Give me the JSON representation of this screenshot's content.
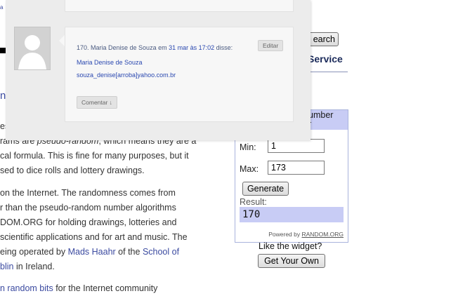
{
  "page": {
    "top_link": "a",
    "left_link": "n",
    "search_button_label": "earch",
    "service_title": "Service",
    "lines": [
      {
        "pre": "es",
        "em": "",
        "post": ""
      },
      {
        "pre": "rams are ",
        "em": "pseudo-random",
        "post": ", which means they are a"
      },
      {
        "pre": "cal formula. This is fine for many purposes, but it",
        "em": "",
        "post": ""
      },
      {
        "pre": "sed to dice rolls and lottery drawings.",
        "em": "",
        "post": ""
      },
      {
        "pre": "on the Internet. The randomness comes from",
        "em": "",
        "post": ""
      },
      {
        "pre": "r than the pseudo-random number algorithms",
        "em": "",
        "post": ""
      },
      {
        "pre": "DOM.ORG for holding drawings, lotteries and",
        "em": "",
        "post": ""
      },
      {
        "pre": "scientific applications and for art and music. The",
        "em": "",
        "post": ""
      }
    ],
    "line_operated": {
      "pre": "eing operated by ",
      "link1": "Mads Haahr",
      "mid": " of the ",
      "link2": "School of"
    },
    "line_dublin": {
      "link": "blin",
      "post": " in Ireland."
    },
    "line_bottom": {
      "link": "n random bits",
      "post": " for the Internet community"
    }
  },
  "widget": {
    "header_line1": "umber",
    "header_line2": "r",
    "min_label": "Min:",
    "min_value": "1",
    "max_label": "Max:",
    "max_value": "173",
    "generate_label": "Generate",
    "result_label": "Result:",
    "result_value": "170",
    "powered_by": "Powered by",
    "powered_link": "RANDOM.ORG",
    "like_text": "Like the widget?",
    "own_button": "Get Your Own"
  },
  "comment": {
    "meta_prefix": "170. Maria Denise de Souza em ",
    "meta_date": "31 mar às 17:02",
    "meta_suffix": " disse:",
    "edit_label": "Editar",
    "line1": "Maria Denise de Souza",
    "line2": "souza_denise[arroba]yahoo.com.br",
    "comment_button": "Comentar ↓"
  },
  "colors": {
    "link": "#3b4aa0",
    "widget_header": "#c8ccf5",
    "overlay_bg": "#ececec"
  }
}
